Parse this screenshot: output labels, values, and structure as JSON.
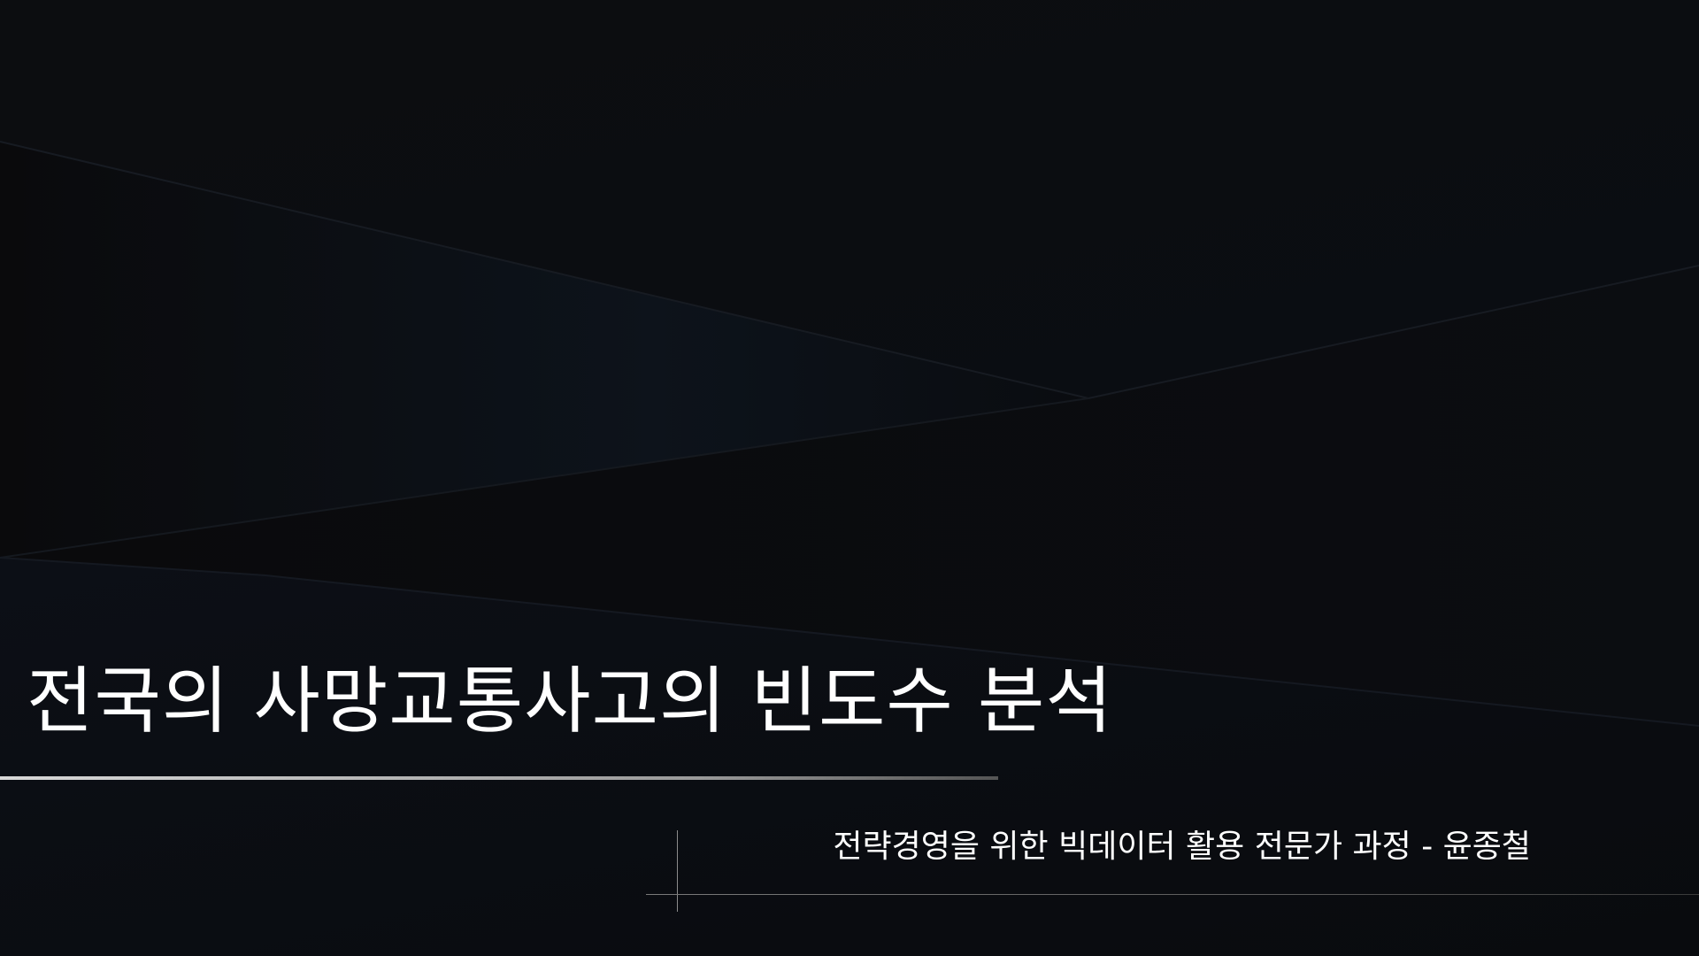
{
  "slide": {
    "title": "전국의 사망교통사고의 빈도수 분석",
    "subtitle": "전략경영을 위한 빅데이터 활용 전문가 과정  -  윤종철"
  },
  "colors": {
    "background": "#07090c",
    "text": "#ffffff",
    "rule": "#c8c8c8"
  }
}
